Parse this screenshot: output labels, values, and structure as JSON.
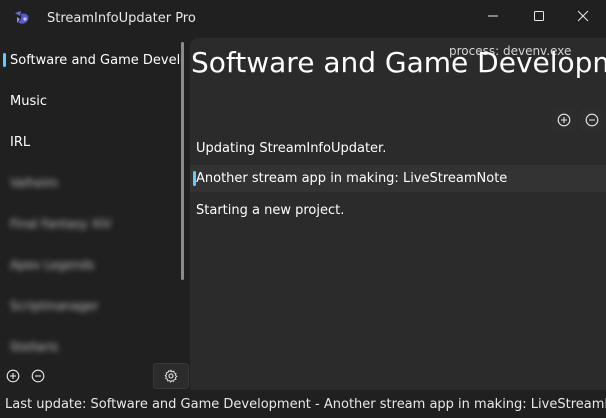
{
  "window": {
    "title": "StreamInfoUpdater Pro"
  },
  "sidebar": {
    "items": [
      {
        "label": "Software and Game Development",
        "selected": true,
        "blurred": false
      },
      {
        "label": "Music",
        "selected": false,
        "blurred": false
      },
      {
        "label": "IRL",
        "selected": false,
        "blurred": false
      },
      {
        "label": "Valheim",
        "selected": false,
        "blurred": true
      },
      {
        "label": "Final Fantasy XIV",
        "selected": false,
        "blurred": true
      },
      {
        "label": "Apex Legends",
        "selected": false,
        "blurred": true
      },
      {
        "label": "Scriptmanager",
        "selected": false,
        "blurred": true
      },
      {
        "label": "Stellaris",
        "selected": false,
        "blurred": true
      }
    ]
  },
  "main": {
    "process_label": "process:  devenv.exe",
    "title": "Software and Game Development",
    "rows": [
      {
        "text": "Updating StreamInfoUpdater.",
        "selected": false
      },
      {
        "text": "Another stream app in making: LiveStreamNote",
        "selected": true
      },
      {
        "text": "Starting a new project.",
        "selected": false
      }
    ]
  },
  "status": {
    "text": "Last update: Software and Game Development - Another stream app in making: LiveStreamNote"
  },
  "colors": {
    "accent": "#60cdff",
    "background": "#202020",
    "panel": "#2b2b2b"
  }
}
